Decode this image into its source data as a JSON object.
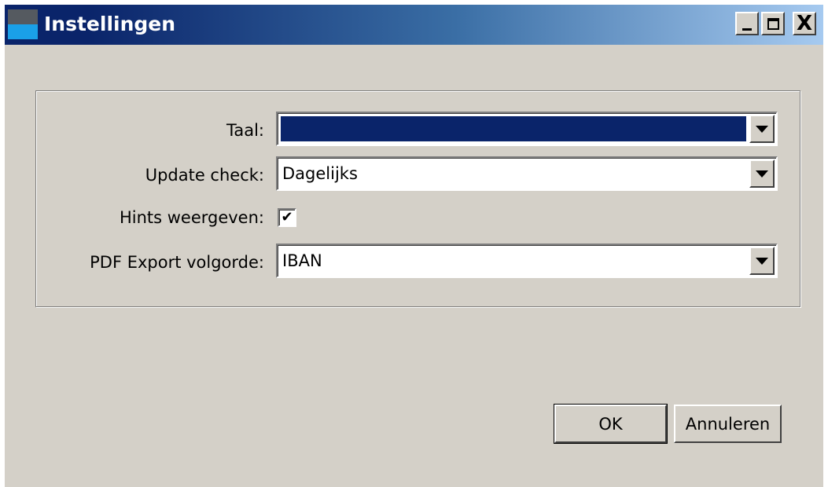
{
  "window": {
    "title": "Instellingen",
    "controls": {
      "minimize": "_",
      "maximize": "□",
      "close": "X"
    }
  },
  "form": {
    "language": {
      "label": "Taal:",
      "value": "",
      "selected": true
    },
    "update_check": {
      "label": "Update check:",
      "value": "Dagelijks"
    },
    "hints": {
      "label": "Hints weergeven:",
      "checked": true,
      "check_glyph": "✔"
    },
    "pdf_export": {
      "label": "PDF Export volgorde:",
      "value": "IBAN"
    }
  },
  "buttons": {
    "ok": "OK",
    "cancel": "Annuleren"
  },
  "colors": {
    "titlebar_start": "#0a246a",
    "titlebar_end": "#a6caf0",
    "selection": "#0a246a",
    "face": "#d4d0c8"
  }
}
